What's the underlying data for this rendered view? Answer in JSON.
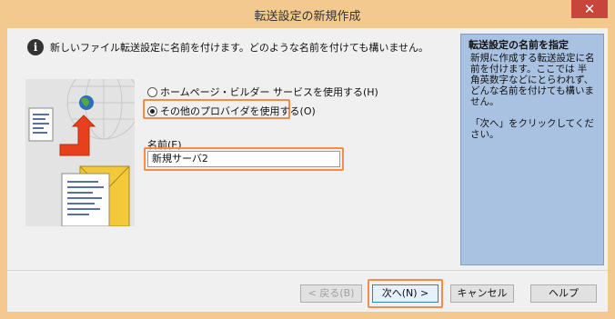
{
  "window": {
    "title": "転送設定の新規作成",
    "close_glyph": "✕"
  },
  "info": {
    "icon_glyph": "i",
    "text": "新しいファイル転送設定に名前を付けます。どのような名前を付けても構いません。"
  },
  "options": [
    {
      "label": "ホームページ・ビルダー サービスを使用する(H)",
      "selected": false
    },
    {
      "label": "その他のプロバイダを使用する(O)",
      "selected": true
    }
  ],
  "name_field": {
    "label": "名前(E)",
    "value": "新規サーバ2"
  },
  "help": {
    "title": "転送設定の名前を指定",
    "body": "新規に作成する転送設定に名前を付けます。ここでは 半角英数字などにとらわれず、どんな名前を付けても構いません。",
    "body2": "「次へ」をクリックしてください。"
  },
  "buttons": {
    "back": "< 戻る(B)",
    "next": "次へ(N) >",
    "cancel": "キャンセル",
    "help": "ヘルプ"
  },
  "colors": {
    "accent_highlight": "#f28c4a",
    "help_panel": "#a9c2e2",
    "window_frame": "#f4c98f",
    "close_button": "#c7453b"
  }
}
